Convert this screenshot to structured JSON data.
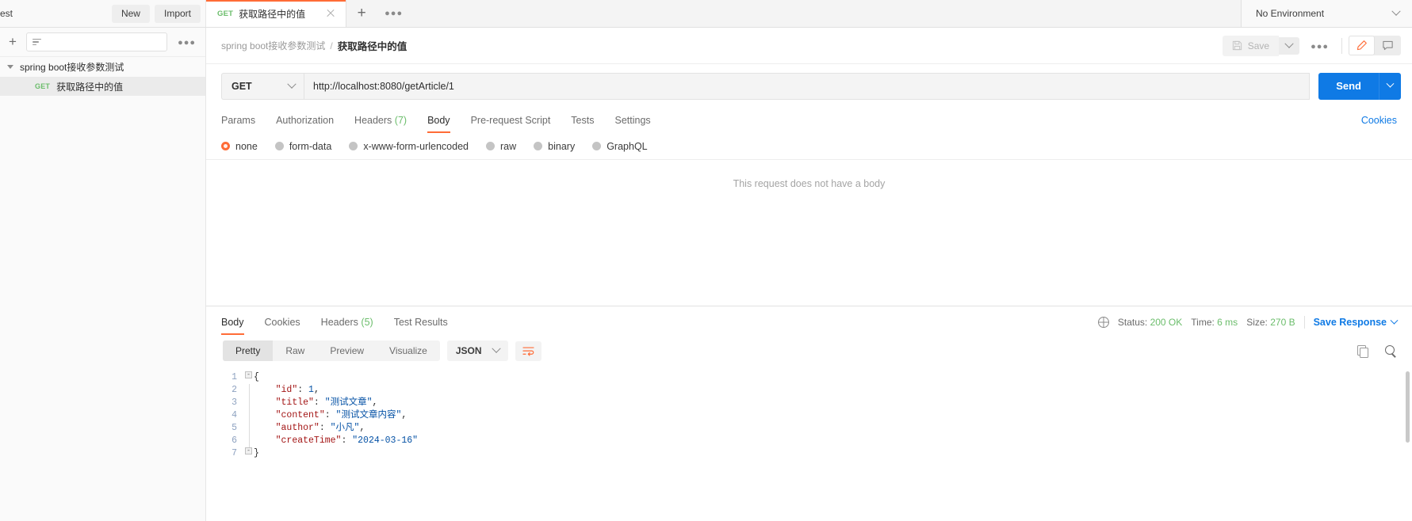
{
  "topbar": {
    "workspace_name": "est",
    "new_label": "New",
    "import_label": "Import",
    "tab": {
      "method": "GET",
      "name": "获取路径中的值"
    },
    "environment": "No Environment"
  },
  "sidebar": {
    "collection": {
      "name": "spring boot接收参数测试",
      "requests": [
        {
          "method": "GET",
          "name": "获取路径中的值"
        }
      ]
    }
  },
  "request": {
    "breadcrumb": {
      "parent": "spring boot接收参数测试",
      "separator": "/",
      "current": "获取路径中的值"
    },
    "save_label": "Save",
    "method": "GET",
    "url": "http://localhost:8080/getArticle/1",
    "send_label": "Send",
    "tabs": [
      {
        "label": "Params",
        "count": "",
        "active": false
      },
      {
        "label": "Authorization",
        "count": "",
        "active": false
      },
      {
        "label": "Headers",
        "count": "(7)",
        "active": false
      },
      {
        "label": "Body",
        "count": "",
        "active": true
      },
      {
        "label": "Pre-request Script",
        "count": "",
        "active": false
      },
      {
        "label": "Tests",
        "count": "",
        "active": false
      },
      {
        "label": "Settings",
        "count": "",
        "active": false
      }
    ],
    "cookies_label": "Cookies",
    "body_types": [
      {
        "label": "none",
        "selected": true
      },
      {
        "label": "form-data",
        "selected": false
      },
      {
        "label": "x-www-form-urlencoded",
        "selected": false
      },
      {
        "label": "raw",
        "selected": false
      },
      {
        "label": "binary",
        "selected": false
      },
      {
        "label": "GraphQL",
        "selected": false
      }
    ],
    "empty_body_text": "This request does not have a body"
  },
  "response": {
    "tabs": [
      {
        "label": "Body",
        "count": "",
        "active": true
      },
      {
        "label": "Cookies",
        "count": "",
        "active": false
      },
      {
        "label": "Headers",
        "count": "(5)",
        "active": false
      },
      {
        "label": "Test Results",
        "count": "",
        "active": false
      }
    ],
    "status_label": "Status:",
    "status_value": "200 OK",
    "time_label": "Time:",
    "time_value": "6 ms",
    "size_label": "Size:",
    "size_value": "270 B",
    "save_response_label": "Save Response",
    "view_modes": [
      {
        "label": "Pretty",
        "active": true
      },
      {
        "label": "Raw",
        "active": false
      },
      {
        "label": "Preview",
        "active": false
      },
      {
        "label": "Visualize",
        "active": false
      }
    ],
    "format": "JSON",
    "body_lines": [
      {
        "n": "1",
        "tokens": [
          {
            "t": "{",
            "c": "brace"
          }
        ]
      },
      {
        "n": "2",
        "tokens": [
          {
            "t": "    ",
            "c": "p"
          },
          {
            "t": "\"id\"",
            "c": "k"
          },
          {
            "t": ": ",
            "c": "p"
          },
          {
            "t": "1",
            "c": "n"
          },
          {
            "t": ",",
            "c": "p"
          }
        ]
      },
      {
        "n": "3",
        "tokens": [
          {
            "t": "    ",
            "c": "p"
          },
          {
            "t": "\"title\"",
            "c": "k"
          },
          {
            "t": ": ",
            "c": "p"
          },
          {
            "t": "\"测试文章\"",
            "c": "s"
          },
          {
            "t": ",",
            "c": "p"
          }
        ]
      },
      {
        "n": "4",
        "tokens": [
          {
            "t": "    ",
            "c": "p"
          },
          {
            "t": "\"content\"",
            "c": "k"
          },
          {
            "t": ": ",
            "c": "p"
          },
          {
            "t": "\"测试文章内容\"",
            "c": "s"
          },
          {
            "t": ",",
            "c": "p"
          }
        ]
      },
      {
        "n": "5",
        "tokens": [
          {
            "t": "    ",
            "c": "p"
          },
          {
            "t": "\"author\"",
            "c": "k"
          },
          {
            "t": ": ",
            "c": "p"
          },
          {
            "t": "\"小凡\"",
            "c": "s"
          },
          {
            "t": ",",
            "c": "p"
          }
        ]
      },
      {
        "n": "6",
        "tokens": [
          {
            "t": "    ",
            "c": "p"
          },
          {
            "t": "\"createTime\"",
            "c": "k"
          },
          {
            "t": ": ",
            "c": "p"
          },
          {
            "t": "\"2024-03-16\"",
            "c": "s"
          }
        ]
      },
      {
        "n": "7",
        "tokens": [
          {
            "t": "}",
            "c": "brace"
          }
        ]
      }
    ]
  },
  "colors": {
    "accent": "#ff6c37",
    "primary": "#0f7ae5",
    "success": "#6bbd6b"
  }
}
